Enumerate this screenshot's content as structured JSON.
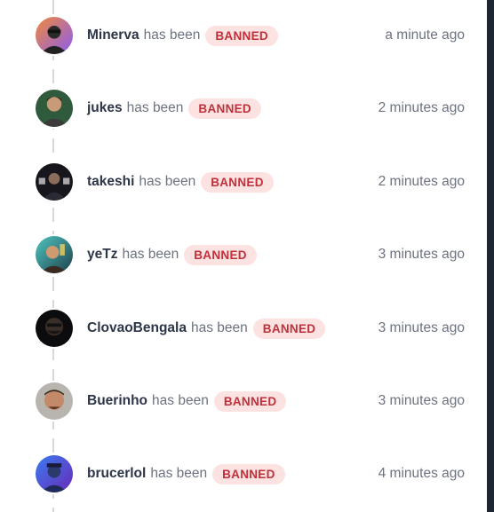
{
  "feed": {
    "items": [
      {
        "username": "Minerva",
        "verb": "has been",
        "status": "BANNED",
        "time": "a minute ago",
        "avatar_icon": "user-avatar-orange-purple"
      },
      {
        "username": "jukes",
        "verb": "has been",
        "status": "BANNED",
        "time": "2 minutes ago",
        "avatar_icon": "user-avatar-green"
      },
      {
        "username": "takeshi",
        "verb": "has been",
        "status": "BANNED",
        "time": "2 minutes ago",
        "avatar_icon": "user-avatar-dark"
      },
      {
        "username": "yeTz",
        "verb": "has been",
        "status": "BANNED",
        "time": "3 minutes ago",
        "avatar_icon": "user-avatar-teal"
      },
      {
        "username": "ClovaoBengala",
        "verb": "has been",
        "status": "BANNED",
        "time": "3 minutes ago",
        "avatar_icon": "user-avatar-black"
      },
      {
        "username": "Buerinho",
        "verb": "has been",
        "status": "BANNED",
        "time": "3 minutes ago",
        "avatar_icon": "user-avatar-grey"
      },
      {
        "username": "brucerlol",
        "verb": "has been",
        "status": "BANNED",
        "time": "4 minutes ago",
        "avatar_icon": "user-avatar-blue-purple"
      }
    ]
  },
  "colors": {
    "badge_bg": "#fde2e2",
    "badge_text": "#c0303a",
    "username": "#2d3648",
    "muted": "#6c7280"
  }
}
